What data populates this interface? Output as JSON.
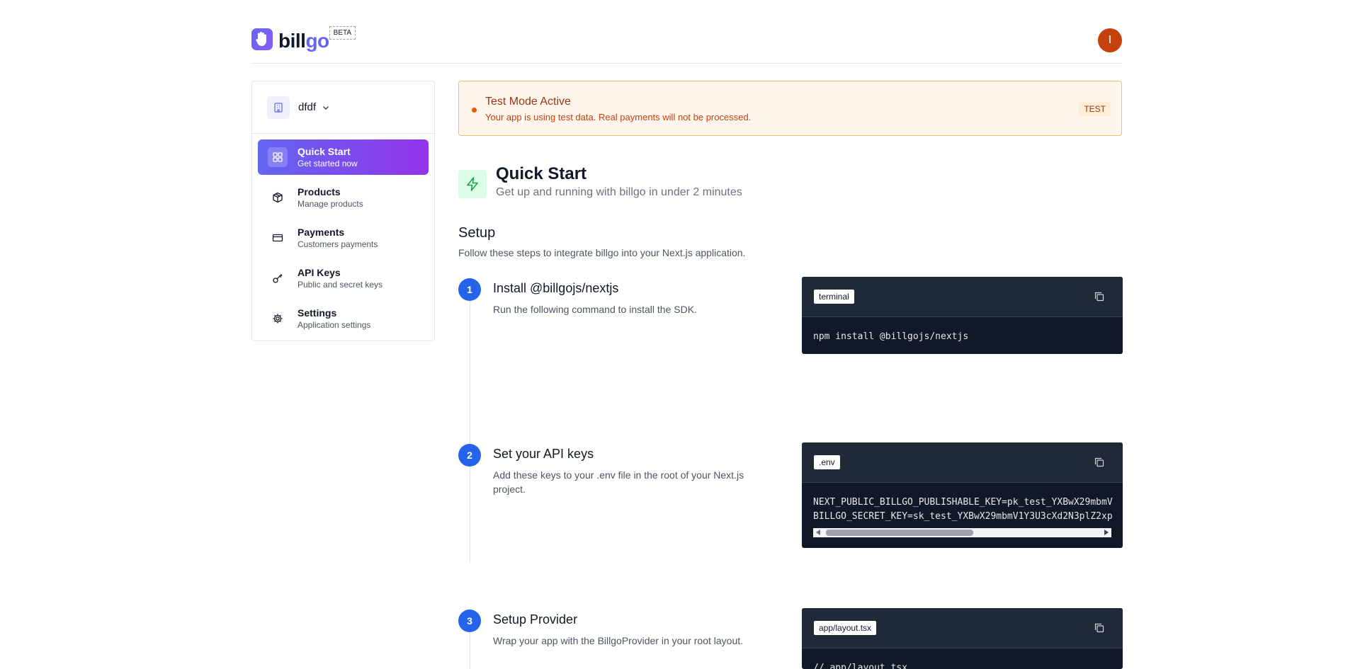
{
  "header": {
    "logo_part1": "bill",
    "logo_part2": "go",
    "beta_label": "BETA",
    "avatar_initial": "I"
  },
  "sidebar": {
    "org_name": "dfdf",
    "items": [
      {
        "title": "Quick Start",
        "subtitle": "Get started now",
        "icon": "grid-icon",
        "active": true
      },
      {
        "title": "Products",
        "subtitle": "Manage products",
        "icon": "box-icon",
        "active": false
      },
      {
        "title": "Payments",
        "subtitle": "Customers payments",
        "icon": "credit-card-icon",
        "active": false
      },
      {
        "title": "API Keys",
        "subtitle": "Public and secret keys",
        "icon": "key-icon",
        "active": false
      },
      {
        "title": "Settings",
        "subtitle": "Application settings",
        "icon": "gear-icon",
        "active": false
      }
    ]
  },
  "banner": {
    "title": "Test Mode Active",
    "text": "Your app is using test data. Real payments will not be processed.",
    "badge": "TEST"
  },
  "quickstart": {
    "title": "Quick Start",
    "subtitle": "Get up and running with billgo in under 2 minutes"
  },
  "setup": {
    "title": "Setup",
    "subtitle": "Follow these steps to integrate billgo into your Next.js application."
  },
  "steps": [
    {
      "number": "1",
      "title": "Install @billgojs/nextjs",
      "description": "Run the following command to install the SDK.",
      "code_tag": "terminal",
      "code": "npm install @billgojs/nextjs"
    },
    {
      "number": "2",
      "title": "Set your API keys",
      "description": "Add these keys to your .env file in the root of your Next.js project.",
      "code_tag": ".env",
      "code": "NEXT_PUBLIC_BILLGO_PUBLISHABLE_KEY=pk_test_YXBwX29mbmV\nBILLGO_SECRET_KEY=sk_test_YXBwX29mbmV1Y3U3cXd2N3plZ2xp"
    },
    {
      "number": "3",
      "title": "Setup Provider",
      "description": "Wrap your app with the BillgoProvider in your root layout.",
      "code_tag": "app/layout.tsx",
      "code": "// app/layout.tsx"
    }
  ],
  "colors": {
    "primary": "#6366f1",
    "active_gradient_end": "#9333ea",
    "step_blue": "#2563eb",
    "warning_bg": "#fff7ed",
    "avatar": "#c2410c",
    "code_bg": "#111827"
  }
}
